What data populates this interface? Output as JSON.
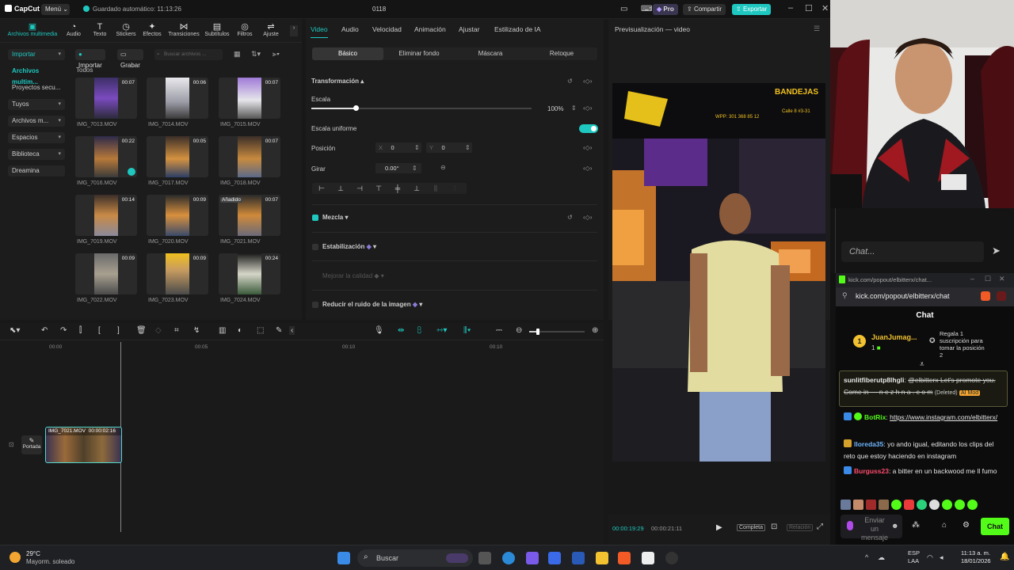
{
  "app": {
    "name": "CapCut",
    "menu_label": "Menú",
    "autosave_text": "Guardado automático: 11:13:26",
    "project_title": "0118",
    "pro_label": "Pro",
    "share_label": "Compartir",
    "export_label": "Exportar",
    "accent": "#1ec8c0"
  },
  "media_tabs": [
    {
      "label": "Archivos multimedia",
      "icon": "media-icon"
    },
    {
      "label": "Audio",
      "icon": "audio-icon"
    },
    {
      "label": "Texto",
      "icon": "text-icon"
    },
    {
      "label": "Stickers",
      "icon": "sticker-icon"
    },
    {
      "label": "Efectos",
      "icon": "effects-icon"
    },
    {
      "label": "Transiciones",
      "icon": "transitions-icon"
    },
    {
      "label": "Subtítulos",
      "icon": "subtitles-icon"
    },
    {
      "label": "Filtros",
      "icon": "filters-icon"
    },
    {
      "label": "Ajuste",
      "icon": "adjust-icon"
    }
  ],
  "sidenav": [
    "Importar",
    "Archivos multim...",
    "Proyectos secu...",
    "Tuyos",
    "Archivos m...",
    "Espacios",
    "Biblioteca",
    "Dreamina"
  ],
  "library": {
    "import_label": "Importar",
    "record_label": "Grabar",
    "search_placeholder": "Buscar archivos ...",
    "section_label": "Todos",
    "items": [
      {
        "name": "IMG_7013.MOV",
        "duration": "00:07"
      },
      {
        "name": "IMG_7014.MOV",
        "duration": "00:06"
      },
      {
        "name": "IMG_7015.MOV",
        "duration": "00:07"
      },
      {
        "name": "IMG_7016.MOV",
        "duration": "00:22"
      },
      {
        "name": "IMG_7017.MOV",
        "duration": "00:05"
      },
      {
        "name": "IMG_7018.MOV",
        "duration": "00:07"
      },
      {
        "name": "IMG_7019.MOV",
        "duration": "00:14"
      },
      {
        "name": "IMG_7020.MOV",
        "duration": "00:09"
      },
      {
        "name": "IMG_7021.MOV",
        "duration": "00:07",
        "tag": "Añadido"
      },
      {
        "name": "IMG_7022.MOV",
        "duration": "00:09"
      },
      {
        "name": "IMG_7023.MOV",
        "duration": "00:09"
      },
      {
        "name": "IMG_7024.MOV",
        "duration": "00:24"
      }
    ]
  },
  "props": {
    "tabs": [
      "Video",
      "Audio",
      "Velocidad",
      "Animación",
      "Ajustar",
      "Estilizado de IA"
    ],
    "subtabs": [
      "Básico",
      "Eliminar fondo",
      "Máscara",
      "Retoque"
    ],
    "transform_label": "Transformación",
    "scale_label": "Escala",
    "scale_value": "100%",
    "scale_level": 0.2,
    "uniform_label": "Escala uniforme",
    "position_label": "Posición",
    "pos_x_label": "X",
    "pos_x": "0",
    "pos_y_label": "Y",
    "pos_y": "0",
    "rotate_label": "Girar",
    "rotate_value": "0.00°",
    "blend_label": "Mezcla",
    "stabilize_label": "Estabilización",
    "quality_label": "Mejorar la calidad",
    "noise_label": "Reducir el ruido de la imagen"
  },
  "preview": {
    "title": "Previsualización — video",
    "current_time": "00:00:19:29",
    "total_time": "00:00:21:11",
    "ratio_label": "Completa",
    "ratio2_label": "Relación",
    "sign_text": "BANDEJAS",
    "sign_phone": "WPP: 301 368 85 12",
    "sign_address": "Calle 8 #3-31"
  },
  "timeline": {
    "ticks": [
      "00:00",
      "00:05",
      "00:10",
      "00:10"
    ],
    "clip_name": "IMG_7021.MOV",
    "clip_duration": "00:00:02:16",
    "cover_label": "Portada"
  },
  "stream_chat": {
    "input_placeholder": "Chat...",
    "url_title": "kick.com/popout/elbitterx/chat...",
    "url": "kick.com/popout/elbitterx/chat",
    "chat_header": "Chat",
    "top_gifter": "JuanJumag...",
    "top_gifter_count": "1",
    "gift_cta": "Regala 1 suscripción para tomar la posición 2",
    "messages": [
      {
        "user": "sunlitfiberutp8lhgli",
        "text": "@elbitterx Let's promote you. Come in — n e z h n a . c o m",
        "deleted": "(Deleted)",
        "mod_label": "AI Mod",
        "color": "#e6e6e6"
      },
      {
        "user": "BotRix",
        "text": "https://www.instagram.com/elbitterx/",
        "color": "#53fc18"
      },
      {
        "user": "lloreda35",
        "text": "yo ando igual, editando los clips del reto que estoy haciendo en instagram",
        "color": "#6fb6ff"
      },
      {
        "user": "Burguss23",
        "text": "a bitter en un backwood me ll fumo",
        "color": "#ff4b6e"
      }
    ],
    "send_placeholder": "Enviar un mensaje",
    "chat_button": "Chat"
  },
  "taskbar": {
    "weather_temp": "29°C",
    "weather_desc": "Mayorm. soleado",
    "search_label": "Buscar",
    "lang": "ESP",
    "lang2": "LAA",
    "time": "11:13 a. m.",
    "date": "18/01/2026"
  }
}
